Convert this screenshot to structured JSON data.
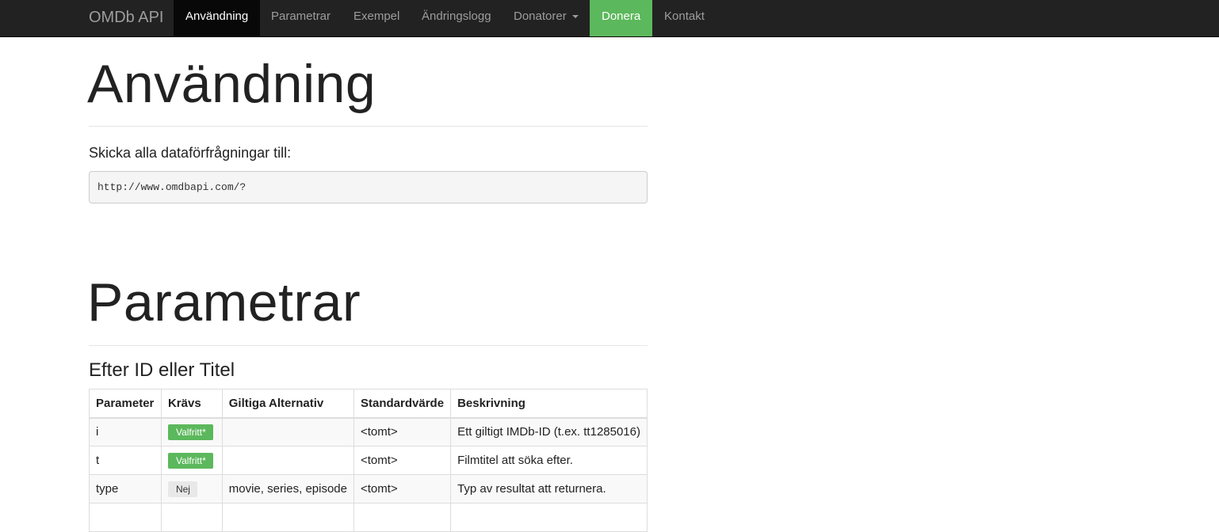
{
  "navbar": {
    "brand": "OMDb API",
    "items": [
      {
        "label": "Användning"
      },
      {
        "label": "Parametrar"
      },
      {
        "label": "Exempel"
      },
      {
        "label": "Ändringslogg"
      },
      {
        "label": "Donatorer"
      },
      {
        "label": "Donera"
      },
      {
        "label": "Kontakt"
      }
    ],
    "active_item": "Användning",
    "colors": {
      "background": "#222222",
      "active": "#080808",
      "donate": "#5cb85c"
    }
  },
  "usage": {
    "heading": "Användning",
    "lead": "Skicka alla dataförfrågningar till:",
    "url": "http://www.omdbapi.com/?"
  },
  "parameters": {
    "heading": "Parametrar",
    "subheading": "Efter ID eller Titel",
    "table": {
      "columns": [
        "Parameter",
        "Krävs",
        "Giltiga Alternativ",
        "Standardvärde",
        "Beskrivning"
      ],
      "rows": [
        {
          "parameter": "i",
          "required": "Valfritt*",
          "required_style": "success",
          "options": "",
          "default": "<tomt>",
          "description": "Ett giltigt IMDb-ID (t.ex. tt1285016)"
        },
        {
          "parameter": "t",
          "required": "Valfritt*",
          "required_style": "success",
          "options": "",
          "default": "<tomt>",
          "description": "Filmtitel att söka efter."
        },
        {
          "parameter": "type",
          "required": "Nej",
          "required_style": "default",
          "options": "movie, series, episode",
          "default": "<tomt>",
          "description": "Typ av resultat att returnera."
        }
      ]
    },
    "colors": {
      "success_label": "#5cb85c",
      "default_label": "#e8e8e8"
    }
  }
}
